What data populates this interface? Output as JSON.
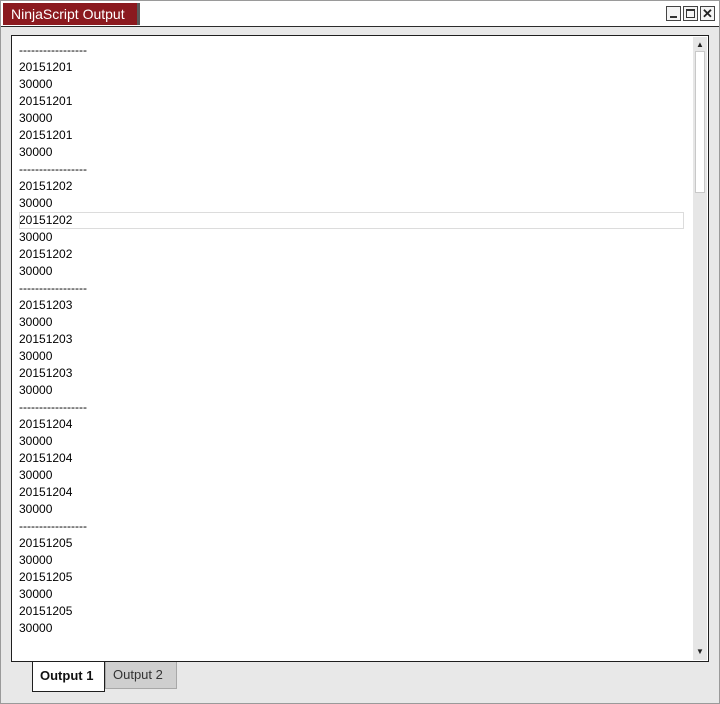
{
  "window": {
    "title": "NinjaScript Output",
    "controls": {
      "minimize": "minimize-icon",
      "maximize": "maximize-icon",
      "close": "close-icon"
    },
    "title_color": "#8b1a1f"
  },
  "output": {
    "lines": [
      "-----------------",
      "20151201",
      "30000",
      "20151201",
      "30000",
      "20151201",
      "30000",
      "-----------------",
      "20151202",
      "30000",
      "20151202",
      "30000",
      "20151202",
      "30000",
      "-----------------",
      "20151203",
      "30000",
      "20151203",
      "30000",
      "20151203",
      "30000",
      "-----------------",
      "20151204",
      "30000",
      "20151204",
      "30000",
      "20151204",
      "30000",
      "-----------------",
      "20151205",
      "30000",
      "20151205",
      "30000",
      "20151205",
      "30000"
    ],
    "selected_line_index": 10
  },
  "tabs": [
    {
      "label": "Output 1",
      "active": true
    },
    {
      "label": "Output 2",
      "active": false
    }
  ]
}
